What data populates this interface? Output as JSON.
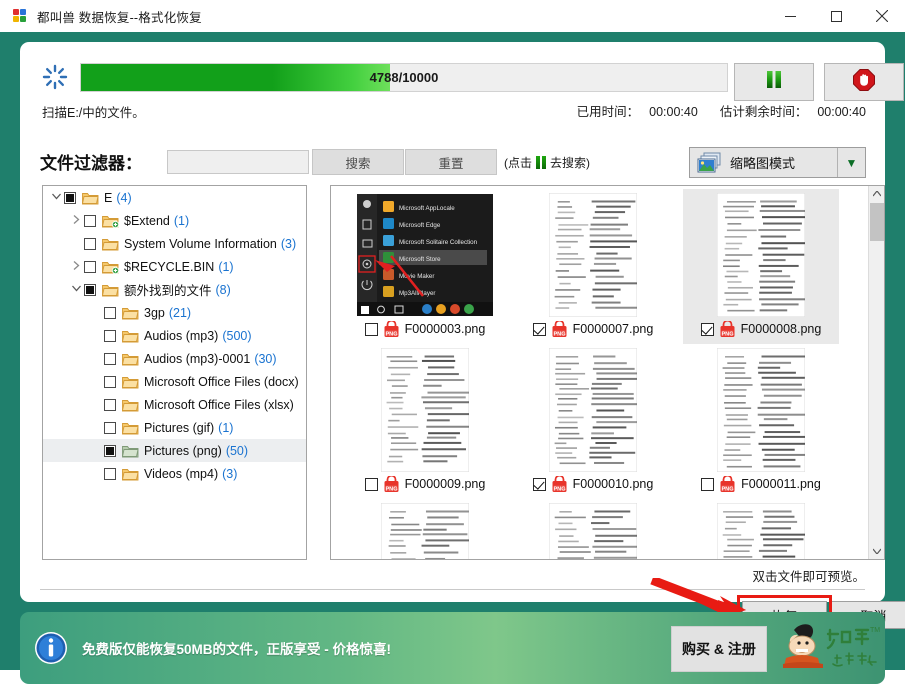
{
  "window": {
    "title": "都叫兽 数据恢复--格式化恢复",
    "app_icon": "puzzle-icon",
    "minimize_label": "–",
    "maximize_label": "□",
    "close_label": "✕"
  },
  "scan": {
    "spinner_icon": "loading-spinner-icon",
    "progress_text": "4788/10000",
    "progress_current": 4788,
    "progress_total": 10000,
    "progress_percent": 47.88,
    "status_text": "扫描E:/中的文件。",
    "pause_icon": "pause-icon",
    "stop_icon": "stop-hand-icon",
    "elapsed_label": "已用时间：",
    "elapsed_value": "00:00:40",
    "remaining_label": "估计剩余时间：",
    "remaining_value": "00:00:40"
  },
  "filter": {
    "label": "文件过滤器：",
    "input_value": "",
    "input_placeholder": "",
    "search_label": "搜索",
    "reset_label": "重置",
    "hint_prefix": "(点击",
    "hint_suffix": "去搜索)",
    "hint_icon": "pause-icon"
  },
  "viewmode": {
    "icon": "thumbnail-mode-icon",
    "label": "缩略图模式",
    "arrow": "▼"
  },
  "tree": {
    "items": [
      {
        "depth": 0,
        "twisty": "v",
        "check": "partial",
        "folder": "folder-open-icon",
        "label": "E",
        "count": "(4)",
        "selected": false
      },
      {
        "depth": 1,
        "twisty": ">",
        "check": "empty",
        "folder": "folder-plus-icon",
        "label": "$Extend",
        "count": "(1)",
        "selected": false
      },
      {
        "depth": 1,
        "twisty": "",
        "check": "empty",
        "folder": "folder-open-icon",
        "label": "System Volume Information",
        "count": "(3)",
        "selected": false
      },
      {
        "depth": 1,
        "twisty": ">",
        "check": "empty",
        "folder": "folder-plus-icon",
        "label": "$RECYCLE.BIN",
        "count": "(1)",
        "selected": false
      },
      {
        "depth": 1,
        "twisty": "v",
        "check": "partial",
        "folder": "folder-open-icon",
        "label": "额外找到的文件",
        "count": "(8)",
        "selected": false
      },
      {
        "depth": 2,
        "twisty": "",
        "check": "empty",
        "folder": "folder-open-icon",
        "label": "3gp",
        "count": "(21)",
        "selected": false
      },
      {
        "depth": 2,
        "twisty": "",
        "check": "empty",
        "folder": "folder-open-icon",
        "label": "Audios (mp3)",
        "count": "(500)",
        "selected": false
      },
      {
        "depth": 2,
        "twisty": "",
        "check": "empty",
        "folder": "folder-open-icon",
        "label": "Audios (mp3)-0001",
        "count": "(30)",
        "selected": false
      },
      {
        "depth": 2,
        "twisty": "",
        "check": "empty",
        "folder": "folder-open-icon",
        "label": "Microsoft Office Files (docx)",
        "count": "",
        "selected": false
      },
      {
        "depth": 2,
        "twisty": "",
        "check": "empty",
        "folder": "folder-open-icon",
        "label": "Microsoft Office Files (xlsx)",
        "count": "",
        "selected": false
      },
      {
        "depth": 2,
        "twisty": "",
        "check": "empty",
        "folder": "folder-open-icon",
        "label": "Pictures (gif)",
        "count": "(1)",
        "selected": false
      },
      {
        "depth": 2,
        "twisty": "",
        "check": "partial",
        "folder": "folder-green-icon",
        "label": "Pictures (png)",
        "count": "(50)",
        "selected": true
      },
      {
        "depth": 2,
        "twisty": "",
        "check": "empty",
        "folder": "folder-open-icon",
        "label": "Videos (mp4)",
        "count": "(3)",
        "selected": false
      }
    ]
  },
  "thumbnails": {
    "items": [
      {
        "name": "F0000003.png",
        "checked": false,
        "selected": false,
        "kind": "screenshot"
      },
      {
        "name": "F0000007.png",
        "checked": true,
        "selected": false,
        "kind": "document"
      },
      {
        "name": "F0000008.png",
        "checked": true,
        "selected": true,
        "kind": "document"
      },
      {
        "name": "F0000009.png",
        "checked": false,
        "selected": false,
        "kind": "document"
      },
      {
        "name": "F0000010.png",
        "checked": true,
        "selected": false,
        "kind": "document"
      },
      {
        "name": "F0000011.png",
        "checked": false,
        "selected": false,
        "kind": "document"
      },
      {
        "name": "",
        "checked": false,
        "selected": false,
        "kind": "document"
      },
      {
        "name": "",
        "checked": false,
        "selected": false,
        "kind": "document"
      },
      {
        "name": "",
        "checked": false,
        "selected": false,
        "kind": "document"
      }
    ],
    "file_icon": "png-file-icon",
    "scroll_up_icon": "chevron-up-icon",
    "scroll_down_icon": "chevron-down-icon"
  },
  "startmenu_thumb": {
    "entries": [
      "Microsoft AppLocale",
      "Microsoft Edge",
      "Microsoft Solitaire Collection",
      "Microsoft Store",
      "Movie Maker",
      "Mp3AllPlayer"
    ]
  },
  "footer": {
    "preview_hint": "双击文件即可预览。",
    "recover_label": "恢复",
    "cancel_label": "取消"
  },
  "banner": {
    "info_icon": "info-icon",
    "message": "免费版仅能恢复50MB的文件，正版享受 - 价格惊喜!",
    "buy_label": "购买 & 注册",
    "brand_icon": "dujiaoshou-mascot-logo",
    "brand_name": "都叫兽",
    "brand_sub": "数据专家"
  },
  "colors": {
    "frame_teal": "#1f7f6c",
    "progress_green": "#12a01a",
    "accent_blue": "#1a73d0",
    "alert_red": "#e81b13",
    "banner_green": "#63b884"
  }
}
